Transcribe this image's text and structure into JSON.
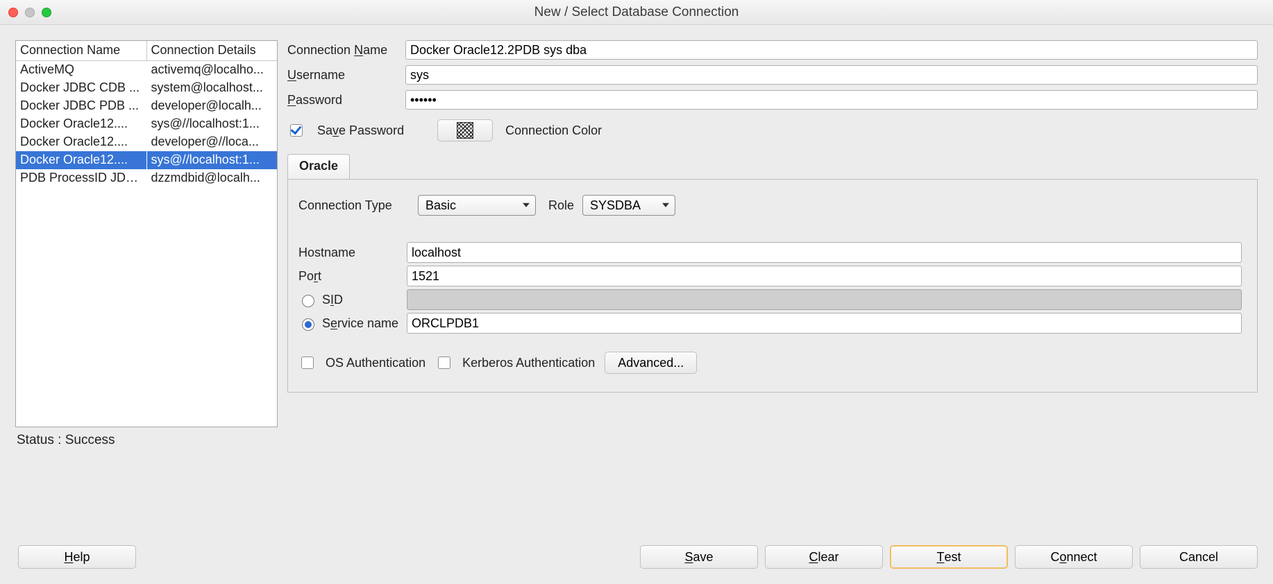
{
  "window": {
    "title": "New / Select Database Connection"
  },
  "connections": {
    "headers": {
      "name": "Connection Name",
      "details": "Connection Details"
    },
    "rows": [
      {
        "name": "ActiveMQ",
        "details": "activemq@localho...",
        "selected": false
      },
      {
        "name": "Docker JDBC CDB ...",
        "details": "system@localhost...",
        "selected": false
      },
      {
        "name": "Docker JDBC PDB ...",
        "details": "developer@localh...",
        "selected": false
      },
      {
        "name": "Docker Oracle12....",
        "details": "sys@//localhost:1...",
        "selected": false
      },
      {
        "name": "Docker Oracle12....",
        "details": "developer@//loca...",
        "selected": false
      },
      {
        "name": "Docker Oracle12....",
        "details": "sys@//localhost:1...",
        "selected": true
      },
      {
        "name": "PDB ProcessID JDBC",
        "details": "dzzmdbid@localh...",
        "selected": false
      }
    ]
  },
  "form": {
    "labels": {
      "connectionName": "Connection Name",
      "connectionNameMnemonic": "N",
      "username": "Username",
      "usernameMnemonic": "U",
      "password": "Password",
      "passwordMnemonic": "P",
      "savePassword": "Save Password",
      "savePasswordMnemonic": "v",
      "connectionColor": "Connection Color"
    },
    "values": {
      "connectionName": "Docker Oracle12.2PDB sys dba",
      "username": "sys",
      "password": "••••••",
      "savePassword": true
    }
  },
  "tab": {
    "oracle": "Oracle"
  },
  "oracle": {
    "labels": {
      "connectionType": "Connection Type",
      "role": "Role",
      "hostname": "Hostname",
      "port": "Port",
      "portMnemonic": "r",
      "sid": "SID",
      "sidMnemonic": "I",
      "serviceName": "Service name",
      "serviceNameMnemonic": "e",
      "osAuth": "OS Authentication",
      "kerberosAuth": "Kerberos Authentication",
      "advanced": "Advanced..."
    },
    "values": {
      "connectionType": "Basic",
      "role": "SYSDBA",
      "hostname": "localhost",
      "port": "1521",
      "sid": "",
      "serviceName": "ORCLPDB1",
      "sidSelected": false,
      "serviceSelected": true,
      "osAuth": false,
      "kerberosAuth": false
    }
  },
  "status": {
    "text": "Status : Success"
  },
  "buttons": {
    "help": "Help",
    "helpMnemonic": "H",
    "save": "Save",
    "saveMnemonic": "S",
    "clear": "Clear",
    "clearMnemonic": "C",
    "test": "Test",
    "testMnemonic": "T",
    "connect": "Connect",
    "connectMnemonic": "o",
    "cancel": "Cancel"
  }
}
